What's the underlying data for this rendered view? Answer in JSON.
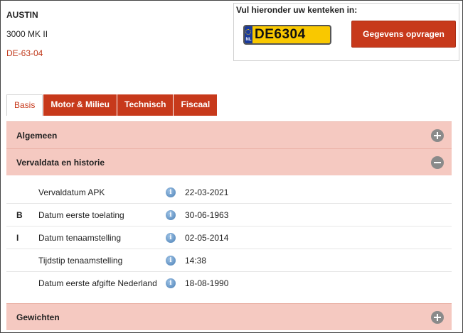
{
  "vehicle": {
    "make": "AUSTIN",
    "model": "3000 MK II",
    "plate": "DE-63-04"
  },
  "lookup": {
    "label": "Vul hieronder uw kenteken in:",
    "plate_value": "DE6304",
    "plate_country": "NL",
    "button_label": "Gegevens opvragen"
  },
  "tabs": [
    {
      "label": "Basis",
      "active": true
    },
    {
      "label": "Motor & Milieu",
      "active": false
    },
    {
      "label": "Technisch",
      "active": false
    },
    {
      "label": "Fiscaal",
      "active": false
    }
  ],
  "sections": {
    "algemeen": {
      "title": "Algemeen",
      "icon": "plus-circle-icon"
    },
    "vervaldata": {
      "title": "Vervaldata en historie",
      "icon": "minus-circle-icon"
    },
    "gewichten": {
      "title": "Gewichten",
      "icon": "plus-circle-icon"
    }
  },
  "rows": [
    {
      "code": "",
      "label": "Vervaldatum APK",
      "value": "22-03-2021"
    },
    {
      "code": "B",
      "label": "Datum eerste toelating",
      "value": "30-06-1963"
    },
    {
      "code": "I",
      "label": "Datum tenaamstelling",
      "value": "02-05-2014"
    },
    {
      "code": "",
      "label": "Tijdstip tenaamstelling",
      "value": "14:38"
    },
    {
      "code": "",
      "label": "Datum eerste afgifte Nederland",
      "value": "18-08-1990"
    }
  ],
  "info_glyph": "i",
  "colors": {
    "accent": "#c7391b",
    "section_bg": "#f5c9c1",
    "plate_yellow": "#f9c800",
    "eu_blue": "#1a3a9a"
  }
}
